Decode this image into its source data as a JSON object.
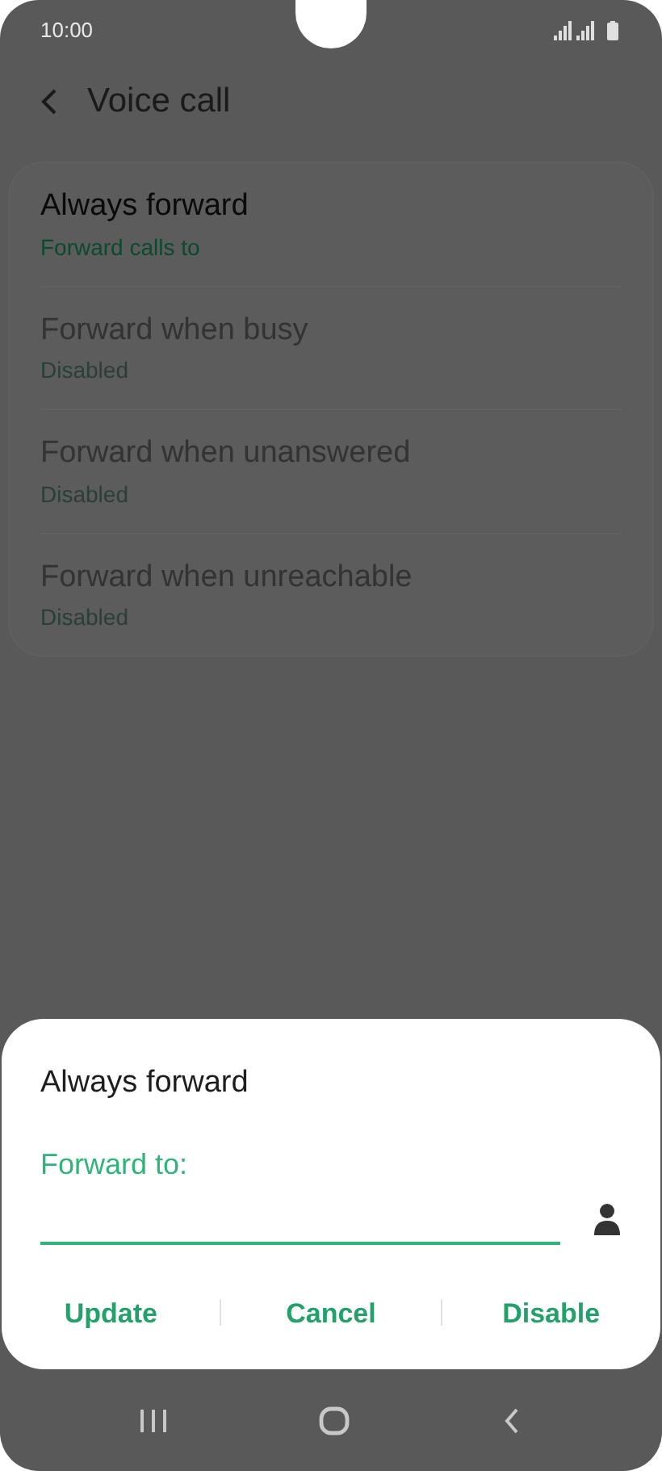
{
  "status_bar": {
    "time": "10:00"
  },
  "header": {
    "title": "Voice call"
  },
  "items": [
    {
      "title": "Always forward",
      "summary": "Forward calls to",
      "disabled": false
    },
    {
      "title": "Forward when busy",
      "summary": "Disabled",
      "disabled": true
    },
    {
      "title": "Forward when unanswered",
      "summary": "Disabled",
      "disabled": true
    },
    {
      "title": "Forward when unreachable",
      "summary": "Disabled",
      "disabled": true
    }
  ],
  "dialog": {
    "title": "Always forward",
    "label": "Forward to:",
    "buttons": [
      "Update",
      "Cancel",
      "Disable"
    ]
  }
}
